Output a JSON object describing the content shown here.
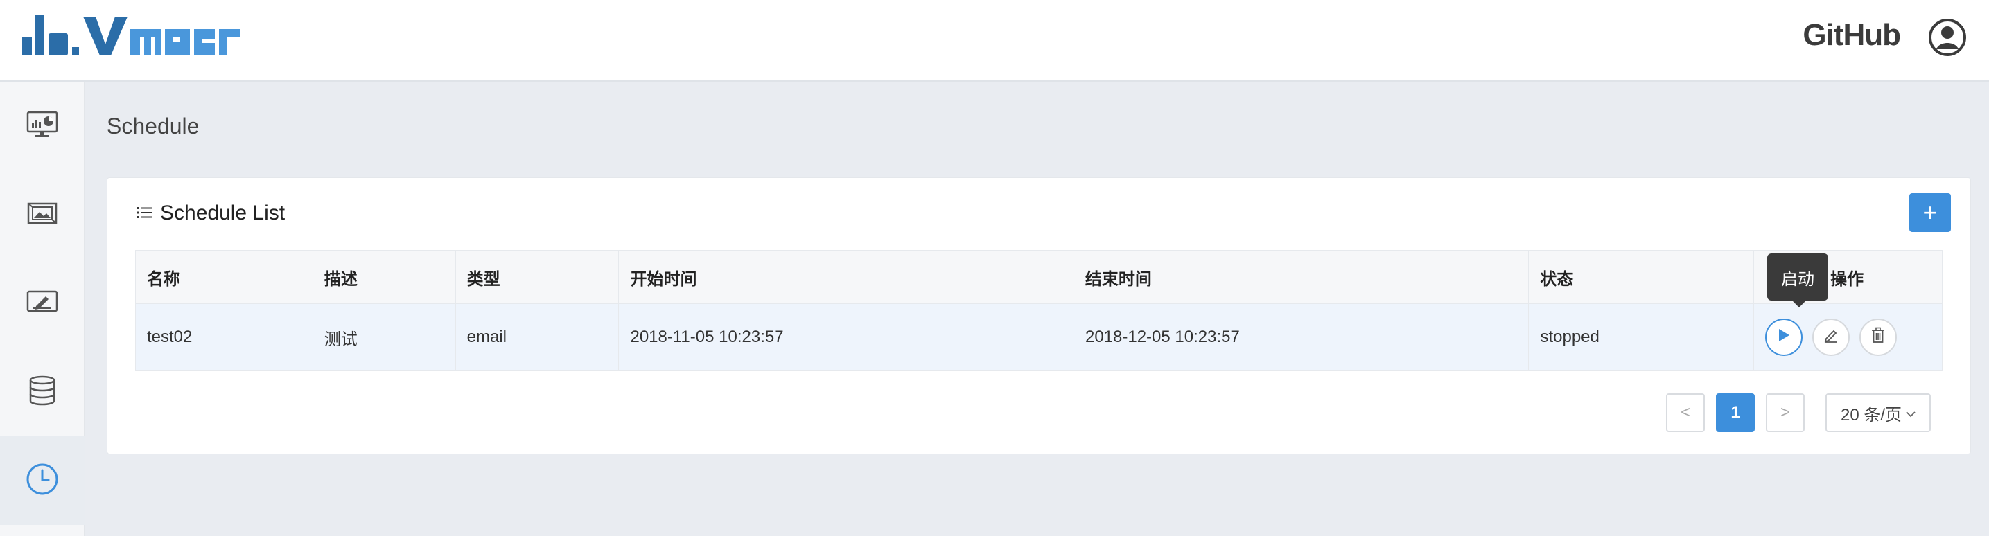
{
  "header": {
    "github_label": "GitHub"
  },
  "sidebar": {
    "items": [
      {
        "icon": "dashboard-monitor-icon"
      },
      {
        "icon": "widget-image-icon"
      },
      {
        "icon": "edit-screen-icon"
      },
      {
        "icon": "database-icon"
      },
      {
        "icon": "clock-icon",
        "active": true
      }
    ]
  },
  "page": {
    "title": "Schedule"
  },
  "card": {
    "title": "Schedule List",
    "add_label": "+"
  },
  "table": {
    "headers": [
      "名称",
      "描述",
      "类型",
      "开始时间",
      "结束时间",
      "状态",
      "操作"
    ],
    "rows": [
      {
        "name": "test02",
        "description": "测试",
        "type": "email",
        "start_time": "2018-11-05 10:23:57",
        "end_time": "2018-12-05 10:23:57",
        "status": "stopped"
      }
    ]
  },
  "tooltip": {
    "label": "启动"
  },
  "pagination": {
    "prev": "<",
    "current_page": "1",
    "next": ">",
    "page_size": "20 条/页"
  },
  "colors": {
    "accent": "#3d8fdc",
    "row_highlight": "#eef4fc"
  }
}
